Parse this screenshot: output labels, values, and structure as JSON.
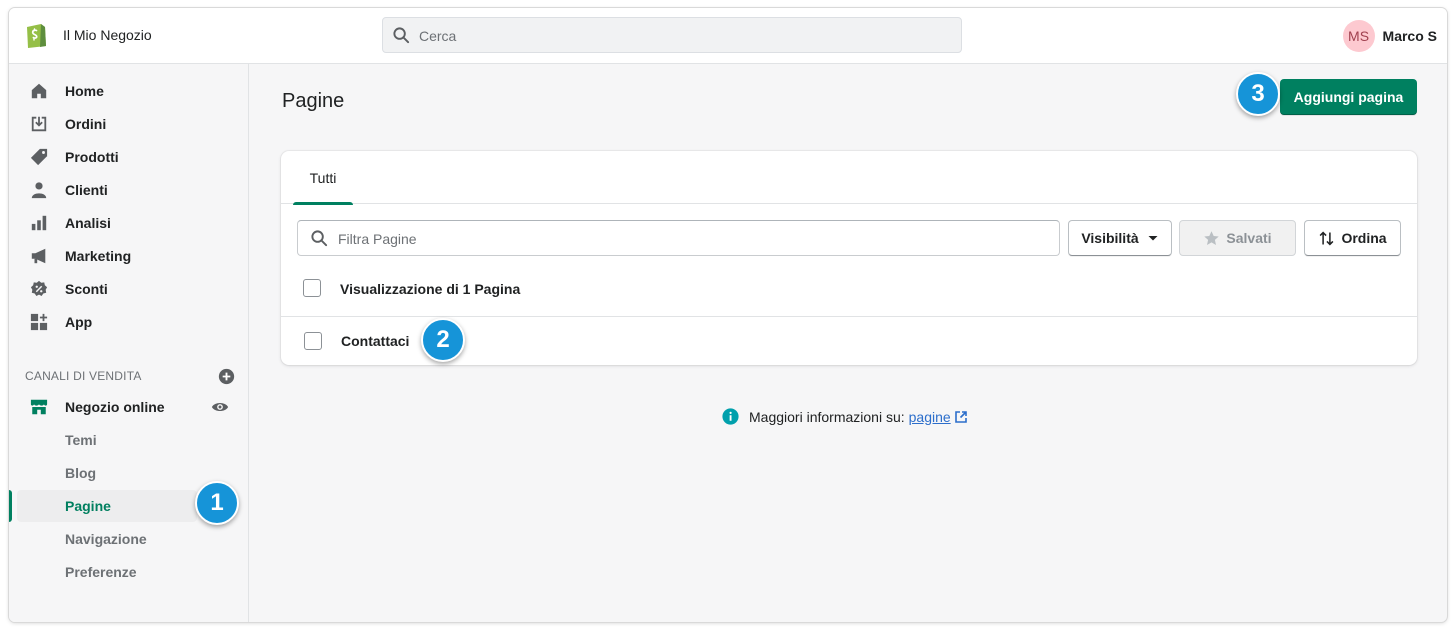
{
  "header": {
    "store_name": "Il Mio Negozio",
    "search_placeholder": "Cerca",
    "user_initials": "MS",
    "user_name": "Marco S"
  },
  "sidebar": {
    "items": [
      {
        "label": "Home",
        "icon": "home-icon"
      },
      {
        "label": "Ordini",
        "icon": "orders-icon"
      },
      {
        "label": "Prodotti",
        "icon": "tag-icon"
      },
      {
        "label": "Clienti",
        "icon": "person-icon"
      },
      {
        "label": "Analisi",
        "icon": "bar-chart-icon"
      },
      {
        "label": "Marketing",
        "icon": "megaphone-icon"
      },
      {
        "label": "Sconti",
        "icon": "discount-icon"
      },
      {
        "label": "App",
        "icon": "apps-icon"
      }
    ],
    "sales_channels_title": "CANALI DI VENDITA",
    "online_store": {
      "label": "Negozio online",
      "icon": "store-icon"
    },
    "sub_items": [
      {
        "label": "Temi",
        "active": false
      },
      {
        "label": "Blog",
        "active": false
      },
      {
        "label": "Pagine",
        "active": true
      },
      {
        "label": "Navigazione",
        "active": false
      },
      {
        "label": "Preferenze",
        "active": false
      }
    ]
  },
  "main": {
    "title": "Pagine",
    "add_button": "Aggiungi pagina",
    "tabs": [
      {
        "label": "Tutti",
        "selected": true
      }
    ],
    "filter_placeholder": "Filtra Pagine",
    "visibility_button": "Visibilità",
    "saved_button": "Salvati",
    "sort_button": "Ordina",
    "list_header": "Visualizzazione di 1 Pagina",
    "rows": [
      {
        "title": "Contattaci"
      }
    ],
    "info_text": "Maggiori informazioni su:",
    "info_link": "pagine"
  },
  "callouts": [
    "1",
    "2",
    "3"
  ],
  "colors": {
    "brand_green": "#008060",
    "active_text": "#007f5f",
    "callout_blue": "#1694d8",
    "link_blue": "#2c6ecb",
    "avatar_bg": "#fdc9d0"
  }
}
